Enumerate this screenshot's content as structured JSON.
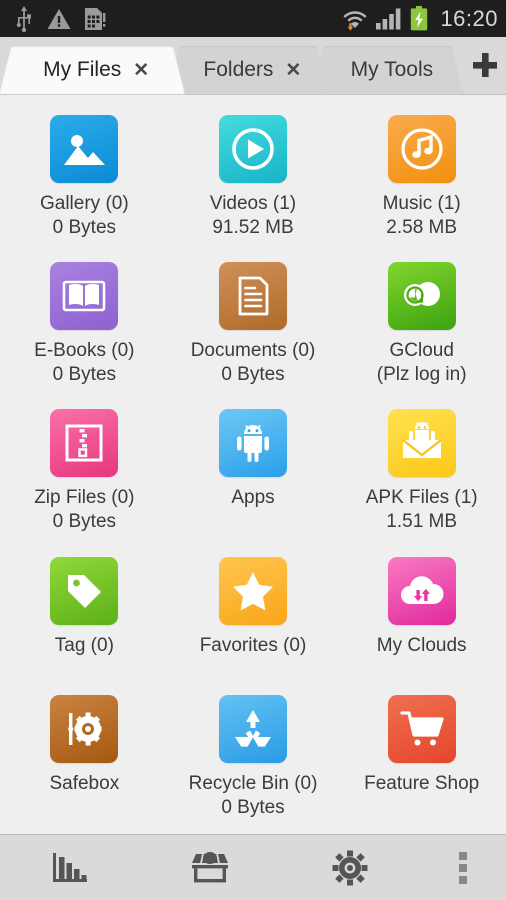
{
  "statusbar": {
    "time": "16:20",
    "icons_left": [
      "usb-icon",
      "warning-triangle-icon",
      "sim-card-icon"
    ],
    "icons_right": [
      "wifi-download-icon",
      "signal-bars-icon",
      "battery-charging-icon"
    ],
    "background": "#1e1e1e",
    "battery_color": "#8cc63f"
  },
  "tabs": [
    {
      "label": "My Files",
      "close": "✕",
      "active": true
    },
    {
      "label": "Folders",
      "close": "✕",
      "active": false
    },
    {
      "label": "My Tools",
      "close": "",
      "active": false
    }
  ],
  "add_tab": {
    "glyph": "+",
    "name": "add-tab-button"
  },
  "grid": {
    "rows": [
      [
        {
          "name": "Gallery (0)",
          "size": "0 Bytes",
          "icon": "gallery-icon",
          "color_top": "#2badea",
          "color_bottom": "#0a8ad6"
        },
        {
          "name": "Videos (1)",
          "size": "91.52 MB",
          "icon": "videos-icon",
          "color_top": "#45dcdf",
          "color_bottom": "#16b4c8"
        },
        {
          "name": "Music (1)",
          "size": "2.58 MB",
          "icon": "music-icon",
          "color_top": "#f9ab4f",
          "color_bottom": "#f2900d"
        }
      ],
      [
        {
          "name": "E-Books (0)",
          "size": "0 Bytes",
          "icon": "ebooks-icon",
          "color_top": "#a882e0",
          "color_bottom": "#8e61d0"
        },
        {
          "name": "Documents (0)",
          "size": "0 Bytes",
          "icon": "documents-icon",
          "color_top": "#cf9159",
          "color_bottom": "#b06a28"
        },
        {
          "name": "GCloud",
          "size": "(Plz log in)",
          "icon": "gcloud-icon",
          "color_top": "#81d62f",
          "color_bottom": "#3ca20e"
        }
      ],
      [
        {
          "name": "Zip Files (0)",
          "size": "0 Bytes",
          "icon": "zip-files-icon",
          "color_top": "#fa72a7",
          "color_bottom": "#e7357e"
        },
        {
          "name": "Apps",
          "size": "",
          "icon": "apps-android-icon",
          "color_top": "#6ec8f5",
          "color_bottom": "#2a9fe8"
        },
        {
          "name": "APK Files (1)",
          "size": "1.51 MB",
          "icon": "apk-files-icon",
          "color_top": "#ffe250",
          "color_bottom": "#fbc818"
        }
      ],
      [
        {
          "name": "Tag (0)",
          "size": "",
          "icon": "tag-icon",
          "color_top": "#92d83a",
          "color_bottom": "#5cb017"
        },
        {
          "name": "Favorites (0)",
          "size": "",
          "icon": "favorites-star-icon",
          "color_top": "#ffc651",
          "color_bottom": "#f9a617"
        },
        {
          "name": "My Clouds",
          "size": "",
          "icon": "my-clouds-icon",
          "color_top": "#f97ac2",
          "color_bottom": "#e1299d"
        }
      ],
      [
        {
          "name": "Safebox",
          "size": "",
          "icon": "safebox-icon",
          "color_top": "#cb8343",
          "color_bottom": "#a4590f"
        },
        {
          "name": "Recycle Bin (0)",
          "size": "0 Bytes",
          "icon": "recycle-bin-icon",
          "color_top": "#63c2f2",
          "color_bottom": "#2a9be6"
        },
        {
          "name": "Feature Shop",
          "size": "",
          "icon": "feature-shop-icon",
          "color_top": "#ef7050",
          "color_bottom": "#e5462b"
        }
      ]
    ]
  },
  "bottombar": {
    "items": [
      {
        "name": "storage-analyze-icon",
        "label": ""
      },
      {
        "name": "market-store-icon",
        "label": ""
      },
      {
        "name": "settings-gear-icon",
        "label": ""
      },
      {
        "name": "overflow-menu-icon",
        "label": ""
      }
    ],
    "icon_color": "#555555"
  }
}
